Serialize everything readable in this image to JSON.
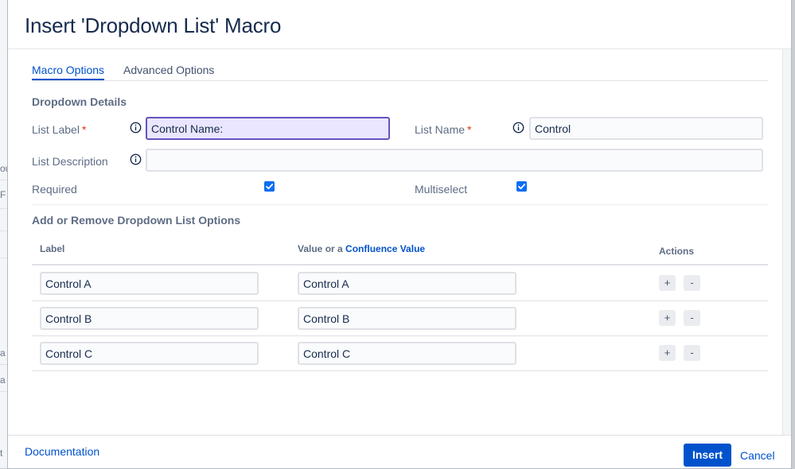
{
  "background": {
    "fragments": [
      "ou",
      "F",
      "a",
      "a",
      "t"
    ]
  },
  "dialog": {
    "title": "Insert 'Dropdown List' Macro",
    "tabs": [
      {
        "label": "Macro Options",
        "active": true
      },
      {
        "label": "Advanced Options",
        "active": false
      }
    ],
    "details": {
      "section_title": "Dropdown Details",
      "list_label": {
        "label": "List Label",
        "required_marker": "*",
        "value": "Control Name:"
      },
      "list_name": {
        "label": "List Name",
        "required_marker": "*",
        "value": "Control"
      },
      "list_description": {
        "label": "List Description",
        "value": ""
      },
      "required": {
        "label": "Required",
        "checked": true
      },
      "multiselect": {
        "label": "Multiselect",
        "checked": true
      }
    },
    "options": {
      "section_title": "Add or Remove Dropdown List Options",
      "columns": {
        "label": "Label",
        "value_prefix": "Value or a",
        "value_link": "Confluence Value",
        "actions": "Actions"
      },
      "rows": [
        {
          "label": "Control A",
          "value": "Control A"
        },
        {
          "label": "Control B",
          "value": "Control B"
        },
        {
          "label": "Control C",
          "value": "Control C"
        }
      ],
      "add_symbol": "+",
      "remove_symbol": "-"
    },
    "footer": {
      "documentation_link": "Documentation",
      "insert_label": "Insert",
      "cancel_label": "Cancel"
    }
  },
  "colors": {
    "accent": "#0052cc",
    "focus_field": "#eae6ff",
    "focus_border": "#6554c0",
    "checkbox": "#0b6ef3",
    "required": "#de350b"
  },
  "icons": {
    "info": "info-circle-icon",
    "check": "checkmark-icon"
  }
}
